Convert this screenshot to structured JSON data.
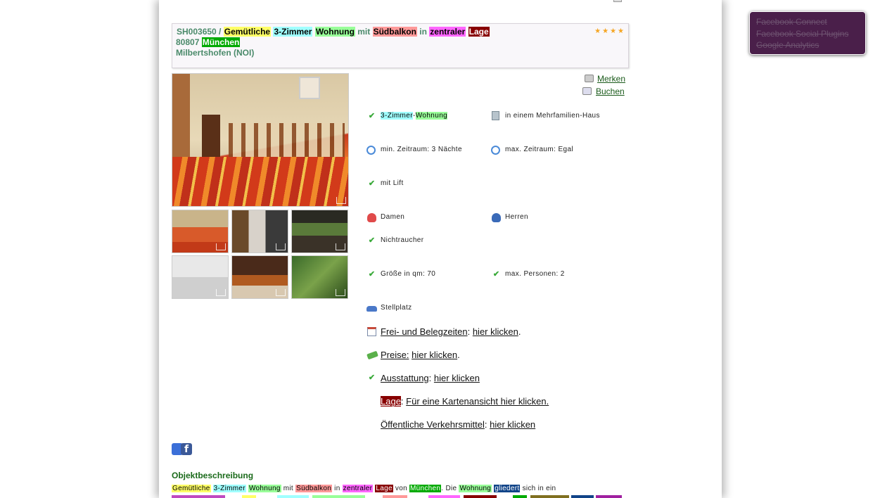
{
  "header": {
    "ref": "SH003650 /",
    "title_words": [
      {
        "text": "Gemütliche",
        "hl": "yellow"
      },
      {
        "text": "3-Zimmer",
        "hl": "cyan"
      },
      {
        "text": "Wohnung",
        "hl": "green"
      },
      {
        "text": "mit",
        "hl": ""
      },
      {
        "text": "Südbalkon",
        "hl": "salmon"
      },
      {
        "text": "in",
        "hl": ""
      },
      {
        "text": "zentraler",
        "hl": "magenta"
      },
      {
        "text": "Lage",
        "hl": "darkred"
      }
    ],
    "zip": "80807",
    "city": "München",
    "district": "Milbertshofen (NOI)",
    "stars": "★★★★"
  },
  "actions": {
    "merken": "Merken",
    "buchen": "Buchen"
  },
  "features": {
    "zimmer": "3-Zimmer",
    "dash": "-",
    "wohnung": "Wohnung",
    "house": "in einem Mehrfamilien-Haus",
    "min_period": "min. Zeitraum: 3 Nächte",
    "max_period": "max. Zeitraum: Egal",
    "lift": "mit Lift",
    "women": "Damen",
    "men": "Herren",
    "nonsmoker": "Nichtraucher",
    "size": "Größe in qm: 70",
    "max_persons": "max. Personen: 2",
    "parking": "Stellplatz"
  },
  "links": {
    "frei_label": "Frei- und Belegzeiten",
    "preise_label": "Preise:",
    "ausstattung_label": "Ausstattung",
    "lage_label": "Lage",
    "lage_link": "Für eine Kartenansicht hier klicken.",
    "oev_label": "Öffentliche Verkehrsmittel",
    "click_here": "hier klicken",
    "colon": ":",
    "period": "."
  },
  "description": {
    "heading": "Objektbeschreibung",
    "words": [
      {
        "text": "Gemütliche",
        "hl": "yellow"
      },
      {
        "text": "3-Zimmer",
        "hl": "cyan"
      },
      {
        "text": "Wohnung",
        "hl": "green"
      },
      {
        "text": "mit",
        "hl": ""
      },
      {
        "text": "Südbalkon",
        "hl": "salmon"
      },
      {
        "text": "in",
        "hl": ""
      },
      {
        "text": "zentraler",
        "hl": "magenta"
      },
      {
        "text": "Lage",
        "hl": "darkred"
      },
      {
        "text": "von",
        "hl": ""
      },
      {
        "text": "München",
        "hl": "brightgreen"
      },
      {
        "text": ". Die",
        "hl": ""
      },
      {
        "text": "Wohnung",
        "hl": "green"
      },
      {
        "text": "gliedert",
        "hl": "blue"
      },
      {
        "text": "sich in ein",
        "hl": ""
      }
    ]
  },
  "tracker": {
    "items": [
      "Facebook Connect",
      "Facebook Social Plugins",
      "Google Analytics"
    ]
  },
  "colors": {
    "link_green": "#1a5a1a",
    "header_green": "#4a8a6a",
    "tracker_bg": "#4a1f4a"
  }
}
